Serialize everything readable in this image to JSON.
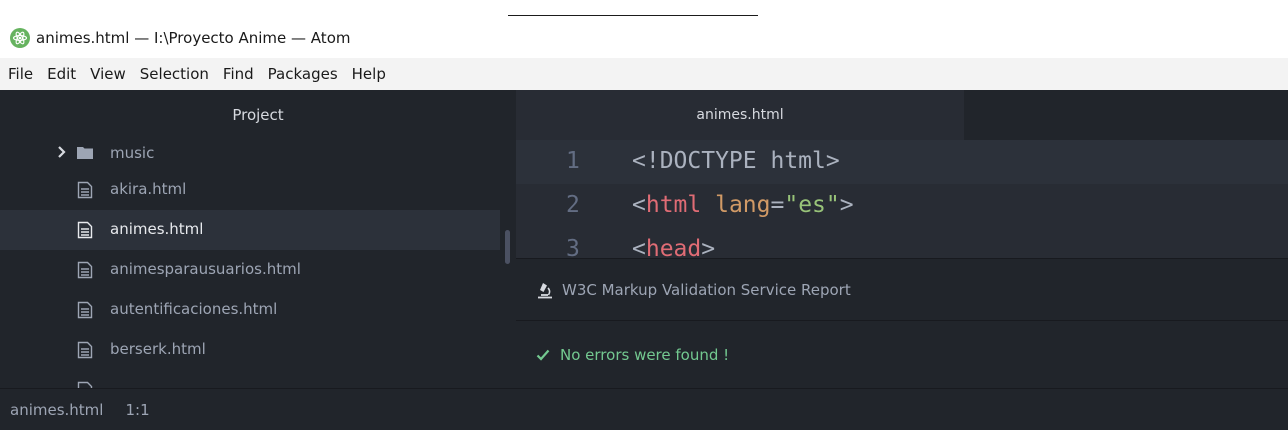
{
  "window": {
    "title": "animes.html — I:\\Proyecto Anime — Atom",
    "app_icon": "atom-icon"
  },
  "menu": [
    {
      "label": "File"
    },
    {
      "label": "Edit"
    },
    {
      "label": "View"
    },
    {
      "label": "Selection"
    },
    {
      "label": "Find"
    },
    {
      "label": "Packages"
    },
    {
      "label": "Help"
    }
  ],
  "tree": {
    "header": "Project",
    "items": [
      {
        "label": "music",
        "type": "folder",
        "icon": "folder-icon",
        "expanded": false,
        "selected": false
      },
      {
        "label": "akira.html",
        "type": "file",
        "icon": "file-text-icon",
        "selected": false
      },
      {
        "label": "animes.html",
        "type": "file",
        "icon": "file-text-icon",
        "selected": true
      },
      {
        "label": "animesparausuarios.html",
        "type": "file",
        "icon": "file-text-icon",
        "selected": false
      },
      {
        "label": "autentificaciones.html",
        "type": "file",
        "icon": "file-text-icon",
        "selected": false
      },
      {
        "label": "berserk.html",
        "type": "file",
        "icon": "file-text-icon",
        "selected": false
      }
    ]
  },
  "editor": {
    "tab_label": "animes.html",
    "lines": [
      {
        "num": "1",
        "parts": [
          {
            "t": "<!DOCTYPE html>",
            "c": "punct"
          }
        ]
      },
      {
        "num": "2",
        "parts": [
          {
            "t": "<",
            "c": "punct"
          },
          {
            "t": "html",
            "c": "tag"
          },
          {
            "t": " ",
            "c": "punct"
          },
          {
            "t": "lang",
            "c": "attr"
          },
          {
            "t": "=",
            "c": "punct"
          },
          {
            "t": "\"es\"",
            "c": "str"
          },
          {
            "t": ">",
            "c": "punct"
          }
        ]
      },
      {
        "num": "3",
        "parts": [
          {
            "t": "<",
            "c": "punct"
          },
          {
            "t": "head",
            "c": "tag"
          },
          {
            "t": ">",
            "c": "punct"
          }
        ]
      }
    ]
  },
  "panel": {
    "title": "W3C Markup Validation Service Report",
    "message": "No errors were found !"
  },
  "status": {
    "file": "animes.html",
    "cursor": "1:1"
  },
  "colors": {
    "tree_bg": "#21252b",
    "editor_bg": "#282c34",
    "selection_bg": "#2c313a",
    "success": "#73c990",
    "tag": "#e06c75",
    "attr": "#d19a66",
    "string": "#98c379"
  }
}
